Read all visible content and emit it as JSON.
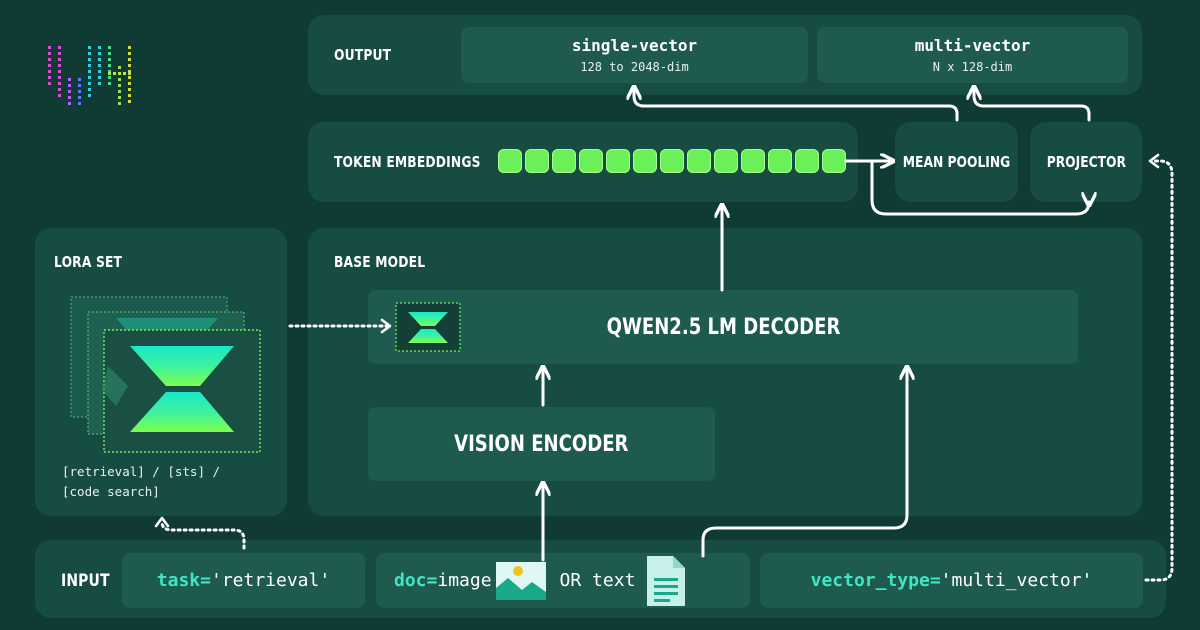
{
  "output": {
    "label": "OUTPUT",
    "single": {
      "title": "single-vector",
      "subtitle": "128 to 2048-dim"
    },
    "multi": {
      "title": "multi-vector",
      "subtitle": "N x 128-dim"
    }
  },
  "embeddings": {
    "label": "TOKEN EMBEDDINGS",
    "token_count": 13,
    "mean_pooling": "MEAN POOLING",
    "projector": "PROJECTOR"
  },
  "lora": {
    "label": "LORA SET",
    "caption_line1": "[retrieval] / [sts] /",
    "caption_line2": "[code search]"
  },
  "base": {
    "label": "BASE MODEL",
    "decoder": "QWEN2.5 LM DECODER",
    "vision": "VISION ENCODER"
  },
  "input": {
    "label": "INPUT",
    "task_key": "task=",
    "task_value": "'retrieval'",
    "doc_key": "doc=",
    "doc_value_image": "image",
    "doc_or_text": "OR text",
    "vector_key": "vector_type=",
    "vector_value": "'multi_vector'"
  },
  "colors": {
    "background": "#0f3b34",
    "panel": "#174c43",
    "inner": "#1f5a4f",
    "accent_green": "#6cf05a",
    "accent_cyan": "#3de6c4"
  },
  "icons": [
    "logo-icon",
    "lora-stack-icon",
    "lora-chip-icon",
    "image-icon",
    "document-icon"
  ]
}
